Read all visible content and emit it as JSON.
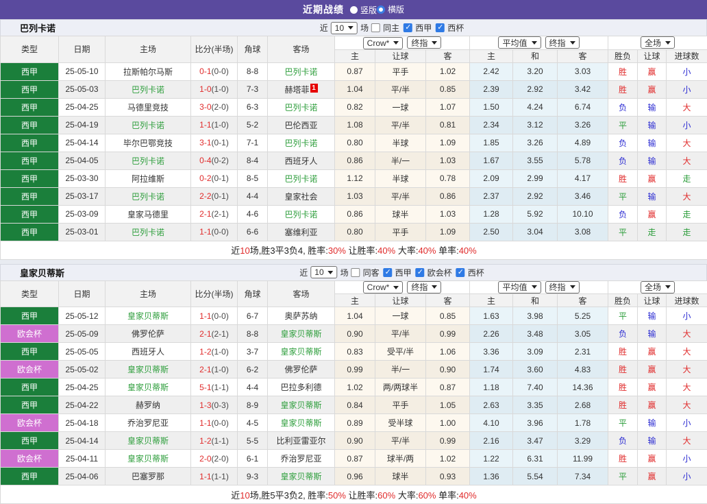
{
  "topbar": {
    "title": "近期战绩",
    "radios": [
      {
        "label": "竖版",
        "selected": false
      },
      {
        "label": "横版",
        "selected": true
      }
    ]
  },
  "colors": {
    "topbar_bg": "#5a4a9e",
    "liga_badge": "#1b7f3b",
    "uefa_badge": "#cf6fd0",
    "focus_team_green": "#2e9e3c",
    "win_red": "#e02b2b",
    "draw_green": "#2a9c39",
    "lose_blue": "#2b2bd2",
    "odds_group_bg": "#fdf8ef",
    "avg_group_bg": "#e9f4f9"
  },
  "table_header": {
    "left_cols": [
      "类型",
      "日期",
      "主场",
      "比分(半场)",
      "角球",
      "客场"
    ],
    "odds_group_selects": [
      "Crow*",
      "终指"
    ],
    "avg_group_selects": [
      "平均值",
      "终指"
    ],
    "result_group_select": "全场",
    "odds_cols": [
      "主",
      "让球",
      "客"
    ],
    "avg_cols": [
      "主",
      "和",
      "客"
    ],
    "result_cols": [
      "胜负",
      "让球",
      "进球数"
    ]
  },
  "sections": [
    {
      "team": "巴列卡诺",
      "filter": {
        "near": "近",
        "count": "10",
        "games": "场",
        "checkboxes": [
          {
            "label": "同主",
            "checked": false
          },
          {
            "label": "西甲",
            "checked": true
          },
          {
            "label": "西杯",
            "checked": true
          }
        ]
      },
      "rows": [
        {
          "league": "西甲",
          "league_type": "liga",
          "date": "25-05-10",
          "home": "拉斯帕尔马斯",
          "home_focus": false,
          "ft": "0-1",
          "ht": "(0-0)",
          "corner": "8-8",
          "away": "巴列卡诺",
          "away_focus": true,
          "away_card": "",
          "odds": [
            "0.87",
            "平手",
            "1.02"
          ],
          "avg": [
            "2.42",
            "3.20",
            "3.03"
          ],
          "results": [
            [
              "胜",
              "red"
            ],
            [
              "赢",
              "red"
            ],
            [
              "小",
              "blue"
            ]
          ]
        },
        {
          "league": "西甲",
          "league_type": "liga",
          "date": "25-05-03",
          "home": "巴列卡诺",
          "home_focus": true,
          "ft": "1-0",
          "ht": "(1-0)",
          "corner": "7-3",
          "away": "赫塔菲",
          "away_focus": false,
          "away_card": "1",
          "odds": [
            "1.04",
            "平/半",
            "0.85"
          ],
          "avg": [
            "2.39",
            "2.92",
            "3.42"
          ],
          "results": [
            [
              "胜",
              "red"
            ],
            [
              "赢",
              "red"
            ],
            [
              "小",
              "blue"
            ]
          ]
        },
        {
          "league": "西甲",
          "league_type": "liga",
          "date": "25-04-25",
          "home": "马德里竞技",
          "home_focus": false,
          "ft": "3-0",
          "ht": "(2-0)",
          "corner": "6-3",
          "away": "巴列卡诺",
          "away_focus": true,
          "away_card": "",
          "odds": [
            "0.82",
            "一球",
            "1.07"
          ],
          "avg": [
            "1.50",
            "4.24",
            "6.74"
          ],
          "results": [
            [
              "负",
              "blue"
            ],
            [
              "输",
              "blue"
            ],
            [
              "大",
              "red"
            ]
          ]
        },
        {
          "league": "西甲",
          "league_type": "liga",
          "date": "25-04-19",
          "home": "巴列卡诺",
          "home_focus": true,
          "ft": "1-1",
          "ht": "(1-0)",
          "corner": "5-2",
          "away": "巴伦西亚",
          "away_focus": false,
          "away_card": "",
          "odds": [
            "1.08",
            "平/半",
            "0.81"
          ],
          "avg": [
            "2.34",
            "3.12",
            "3.26"
          ],
          "results": [
            [
              "平",
              "green"
            ],
            [
              "输",
              "blue"
            ],
            [
              "小",
              "blue"
            ]
          ]
        },
        {
          "league": "西甲",
          "league_type": "liga",
          "date": "25-04-14",
          "home": "毕尔巴鄂竞技",
          "home_focus": false,
          "ft": "3-1",
          "ht": "(0-1)",
          "corner": "7-1",
          "away": "巴列卡诺",
          "away_focus": true,
          "away_card": "",
          "odds": [
            "0.80",
            "半球",
            "1.09"
          ],
          "avg": [
            "1.85",
            "3.26",
            "4.89"
          ],
          "results": [
            [
              "负",
              "blue"
            ],
            [
              "输",
              "blue"
            ],
            [
              "大",
              "red"
            ]
          ]
        },
        {
          "league": "西甲",
          "league_type": "liga",
          "date": "25-04-05",
          "home": "巴列卡诺",
          "home_focus": true,
          "ft": "0-4",
          "ht": "(0-2)",
          "corner": "8-4",
          "away": "西班牙人",
          "away_focus": false,
          "away_card": "",
          "odds": [
            "0.86",
            "半/一",
            "1.03"
          ],
          "avg": [
            "1.67",
            "3.55",
            "5.78"
          ],
          "results": [
            [
              "负",
              "blue"
            ],
            [
              "输",
              "blue"
            ],
            [
              "大",
              "red"
            ]
          ]
        },
        {
          "league": "西甲",
          "league_type": "liga",
          "date": "25-03-30",
          "home": "阿拉维斯",
          "home_focus": false,
          "ft": "0-2",
          "ht": "(0-1)",
          "corner": "8-5",
          "away": "巴列卡诺",
          "away_focus": true,
          "away_card": "",
          "odds": [
            "1.12",
            "半球",
            "0.78"
          ],
          "avg": [
            "2.09",
            "2.99",
            "4.17"
          ],
          "results": [
            [
              "胜",
              "red"
            ],
            [
              "赢",
              "red"
            ],
            [
              "走",
              "green"
            ]
          ]
        },
        {
          "league": "西甲",
          "league_type": "liga",
          "date": "25-03-17",
          "home": "巴列卡诺",
          "home_focus": true,
          "ft": "2-2",
          "ht": "(0-1)",
          "corner": "4-4",
          "away": "皇家社会",
          "away_focus": false,
          "away_card": "",
          "odds": [
            "1.03",
            "平/半",
            "0.86"
          ],
          "avg": [
            "2.37",
            "2.92",
            "3.46"
          ],
          "results": [
            [
              "平",
              "green"
            ],
            [
              "输",
              "blue"
            ],
            [
              "大",
              "red"
            ]
          ]
        },
        {
          "league": "西甲",
          "league_type": "liga",
          "date": "25-03-09",
          "home": "皇家马德里",
          "home_focus": false,
          "ft": "2-1",
          "ht": "(2-1)",
          "corner": "4-6",
          "away": "巴列卡诺",
          "away_focus": true,
          "away_card": "",
          "odds": [
            "0.86",
            "球半",
            "1.03"
          ],
          "avg": [
            "1.28",
            "5.92",
            "10.10"
          ],
          "results": [
            [
              "负",
              "blue"
            ],
            [
              "赢",
              "red"
            ],
            [
              "走",
              "green"
            ]
          ]
        },
        {
          "league": "西甲",
          "league_type": "liga",
          "date": "25-03-01",
          "home": "巴列卡诺",
          "home_focus": true,
          "ft": "1-1",
          "ht": "(0-0)",
          "corner": "6-6",
          "away": "塞维利亚",
          "away_focus": false,
          "away_card": "",
          "odds": [
            "0.80",
            "平手",
            "1.09"
          ],
          "avg": [
            "2.50",
            "3.04",
            "3.08"
          ],
          "results": [
            [
              "平",
              "green"
            ],
            [
              "走",
              "green"
            ],
            [
              "走",
              "green"
            ]
          ]
        }
      ],
      "summary": [
        [
          "近",
          "k"
        ],
        [
          "10",
          "r"
        ],
        [
          "场,胜3平3负4, 胜率:",
          "k"
        ],
        [
          "30%",
          "r"
        ],
        [
          " 让胜率:",
          "k"
        ],
        [
          "40%",
          "r"
        ],
        [
          " 大率:",
          "k"
        ],
        [
          "40%",
          "r"
        ],
        [
          " 单率:",
          "k"
        ],
        [
          "40%",
          "r"
        ]
      ]
    },
    {
      "team": "皇家贝蒂斯",
      "filter": {
        "near": "近",
        "count": "10",
        "games": "场",
        "checkboxes": [
          {
            "label": "同客",
            "checked": false
          },
          {
            "label": "西甲",
            "checked": true
          },
          {
            "label": "欧会杯",
            "checked": true
          },
          {
            "label": "西杯",
            "checked": true
          }
        ]
      },
      "rows": [
        {
          "league": "西甲",
          "league_type": "liga",
          "date": "25-05-12",
          "home": "皇家贝蒂斯",
          "home_focus": true,
          "ft": "1-1",
          "ht": "(0-0)",
          "corner": "6-7",
          "away": "奥萨苏纳",
          "away_focus": false,
          "away_card": "",
          "odds": [
            "1.04",
            "一球",
            "0.85"
          ],
          "avg": [
            "1.63",
            "3.98",
            "5.25"
          ],
          "results": [
            [
              "平",
              "green"
            ],
            [
              "输",
              "blue"
            ],
            [
              "小",
              "blue"
            ]
          ]
        },
        {
          "league": "欧会杯",
          "league_type": "uefa",
          "date": "25-05-09",
          "home": "佛罗伦萨",
          "home_focus": false,
          "ft": "2-1",
          "ht": "(2-1)",
          "corner": "8-8",
          "away": "皇家贝蒂斯",
          "away_focus": true,
          "away_card": "",
          "odds": [
            "0.90",
            "平/半",
            "0.99"
          ],
          "avg": [
            "2.26",
            "3.48",
            "3.05"
          ],
          "results": [
            [
              "负",
              "blue"
            ],
            [
              "输",
              "blue"
            ],
            [
              "大",
              "red"
            ]
          ]
        },
        {
          "league": "西甲",
          "league_type": "liga",
          "date": "25-05-05",
          "home": "西班牙人",
          "home_focus": false,
          "ft": "1-2",
          "ht": "(1-0)",
          "corner": "3-7",
          "away": "皇家贝蒂斯",
          "away_focus": true,
          "away_card": "",
          "odds": [
            "0.83",
            "受平/半",
            "1.06"
          ],
          "avg": [
            "3.36",
            "3.09",
            "2.31"
          ],
          "results": [
            [
              "胜",
              "red"
            ],
            [
              "赢",
              "red"
            ],
            [
              "大",
              "red"
            ]
          ]
        },
        {
          "league": "欧会杯",
          "league_type": "uefa",
          "date": "25-05-02",
          "home": "皇家贝蒂斯",
          "home_focus": true,
          "ft": "2-1",
          "ht": "(1-0)",
          "corner": "6-2",
          "away": "佛罗伦萨",
          "away_focus": false,
          "away_card": "",
          "odds": [
            "0.99",
            "半/一",
            "0.90"
          ],
          "avg": [
            "1.74",
            "3.60",
            "4.83"
          ],
          "results": [
            [
              "胜",
              "red"
            ],
            [
              "赢",
              "red"
            ],
            [
              "大",
              "red"
            ]
          ]
        },
        {
          "league": "西甲",
          "league_type": "liga",
          "date": "25-04-25",
          "home": "皇家贝蒂斯",
          "home_focus": true,
          "ft": "5-1",
          "ht": "(1-1)",
          "corner": "4-4",
          "away": "巴拉多利德",
          "away_focus": false,
          "away_card": "",
          "odds": [
            "1.02",
            "两/两球半",
            "0.87"
          ],
          "avg": [
            "1.18",
            "7.40",
            "14.36"
          ],
          "results": [
            [
              "胜",
              "red"
            ],
            [
              "赢",
              "red"
            ],
            [
              "大",
              "red"
            ]
          ]
        },
        {
          "league": "西甲",
          "league_type": "liga",
          "date": "25-04-22",
          "home": "赫罗纳",
          "home_focus": false,
          "ft": "1-3",
          "ht": "(0-3)",
          "corner": "8-9",
          "away": "皇家贝蒂斯",
          "away_focus": true,
          "away_card": "",
          "odds": [
            "0.84",
            "平手",
            "1.05"
          ],
          "avg": [
            "2.63",
            "3.35",
            "2.68"
          ],
          "results": [
            [
              "胜",
              "red"
            ],
            [
              "赢",
              "red"
            ],
            [
              "大",
              "red"
            ]
          ]
        },
        {
          "league": "欧会杯",
          "league_type": "uefa",
          "date": "25-04-18",
          "home": "乔治罗尼亚",
          "home_focus": false,
          "ft": "1-1",
          "ht": "(0-0)",
          "corner": "4-5",
          "away": "皇家贝蒂斯",
          "away_focus": true,
          "away_card": "",
          "odds": [
            "0.89",
            "受半球",
            "1.00"
          ],
          "avg": [
            "4.10",
            "3.96",
            "1.78"
          ],
          "results": [
            [
              "平",
              "green"
            ],
            [
              "输",
              "blue"
            ],
            [
              "小",
              "blue"
            ]
          ]
        },
        {
          "league": "西甲",
          "league_type": "liga",
          "date": "25-04-14",
          "home": "皇家贝蒂斯",
          "home_focus": true,
          "ft": "1-2",
          "ht": "(1-1)",
          "corner": "5-5",
          "away": "比利亚雷亚尔",
          "away_focus": false,
          "away_card": "",
          "odds": [
            "0.90",
            "平/半",
            "0.99"
          ],
          "avg": [
            "2.16",
            "3.47",
            "3.29"
          ],
          "results": [
            [
              "负",
              "blue"
            ],
            [
              "输",
              "blue"
            ],
            [
              "大",
              "red"
            ]
          ]
        },
        {
          "league": "欧会杯",
          "league_type": "uefa",
          "date": "25-04-11",
          "home": "皇家贝蒂斯",
          "home_focus": true,
          "ft": "2-0",
          "ht": "(2-0)",
          "corner": "6-1",
          "away": "乔治罗尼亚",
          "away_focus": false,
          "away_card": "",
          "odds": [
            "0.87",
            "球半/两",
            "1.02"
          ],
          "avg": [
            "1.22",
            "6.31",
            "11.99"
          ],
          "results": [
            [
              "胜",
              "red"
            ],
            [
              "赢",
              "red"
            ],
            [
              "小",
              "blue"
            ]
          ]
        },
        {
          "league": "西甲",
          "league_type": "liga",
          "date": "25-04-06",
          "home": "巴塞罗那",
          "home_focus": false,
          "ft": "1-1",
          "ht": "(1-1)",
          "corner": "9-3",
          "away": "皇家贝蒂斯",
          "away_focus": true,
          "away_card": "",
          "odds": [
            "0.96",
            "球半",
            "0.93"
          ],
          "avg": [
            "1.36",
            "5.54",
            "7.34"
          ],
          "results": [
            [
              "平",
              "green"
            ],
            [
              "赢",
              "red"
            ],
            [
              "小",
              "blue"
            ]
          ]
        }
      ],
      "summary": [
        [
          "近",
          "k"
        ],
        [
          "10",
          "r"
        ],
        [
          "场,胜5平3负2, 胜率:",
          "k"
        ],
        [
          "50%",
          "r"
        ],
        [
          " 让胜率:",
          "k"
        ],
        [
          "60%",
          "r"
        ],
        [
          " 大率:",
          "k"
        ],
        [
          "60%",
          "r"
        ],
        [
          " 单率:",
          "k"
        ],
        [
          "40%",
          "r"
        ]
      ]
    }
  ]
}
